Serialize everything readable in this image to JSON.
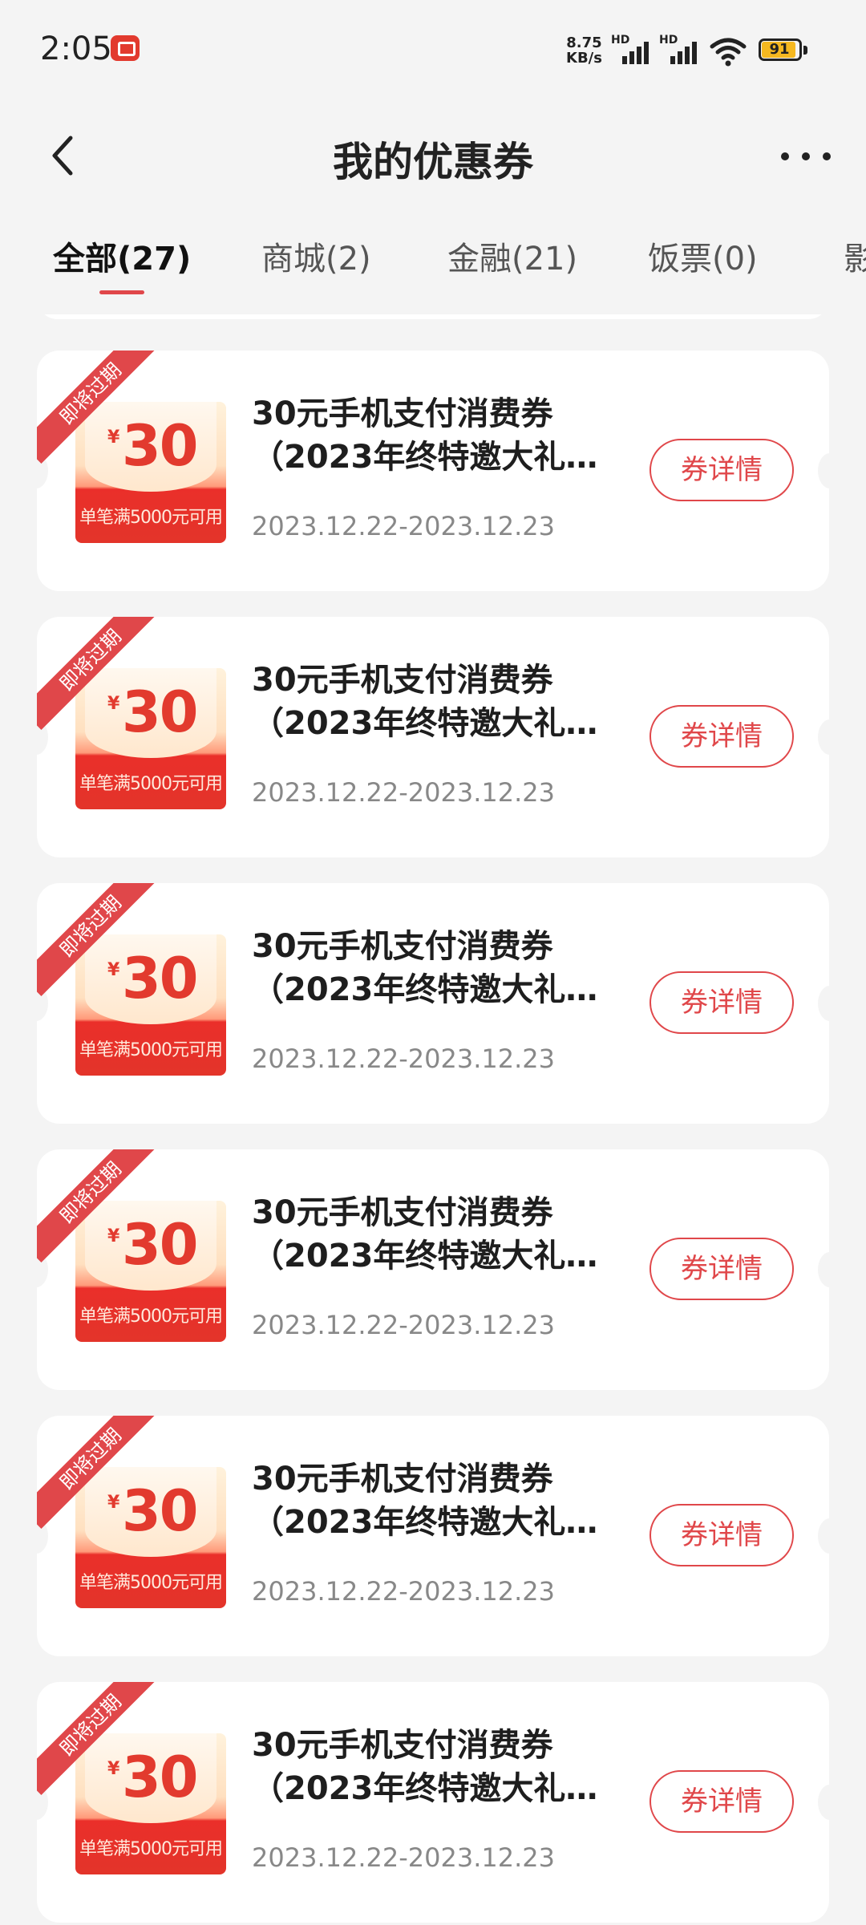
{
  "status_bar": {
    "time": "2:05",
    "net_speed_value": "8.75",
    "net_speed_unit": "KB/s",
    "hd_label": "HD",
    "battery": "91"
  },
  "header": {
    "title": "我的优惠券"
  },
  "tabs": [
    {
      "label": "全部(27)",
      "active": true
    },
    {
      "label": "商城(2)"
    },
    {
      "label": "金融(21)"
    },
    {
      "label": "饭票(0)"
    },
    {
      "label": "影"
    }
  ],
  "coupons": [
    {
      "ribbon": "即将过期",
      "currency": "¥",
      "amount": "30",
      "condition": "单笔满5000元可用",
      "title_line1": "30元手机支付消费券",
      "title_line2": "（2023年终特邀大礼…",
      "date": "2023.12.22-2023.12.23",
      "button": "券详情"
    },
    {
      "ribbon": "即将过期",
      "currency": "¥",
      "amount": "30",
      "condition": "单笔满5000元可用",
      "title_line1": "30元手机支付消费券",
      "title_line2": "（2023年终特邀大礼…",
      "date": "2023.12.22-2023.12.23",
      "button": "券详情"
    },
    {
      "ribbon": "即将过期",
      "currency": "¥",
      "amount": "30",
      "condition": "单笔满5000元可用",
      "title_line1": "30元手机支付消费券",
      "title_line2": "（2023年终特邀大礼…",
      "date": "2023.12.22-2023.12.23",
      "button": "券详情"
    },
    {
      "ribbon": "即将过期",
      "currency": "¥",
      "amount": "30",
      "condition": "单笔满5000元可用",
      "title_line1": "30元手机支付消费券",
      "title_line2": "（2023年终特邀大礼…",
      "date": "2023.12.22-2023.12.23",
      "button": "券详情"
    },
    {
      "ribbon": "即将过期",
      "currency": "¥",
      "amount": "30",
      "condition": "单笔满5000元可用",
      "title_line1": "30元手机支付消费券",
      "title_line2": "（2023年终特邀大礼…",
      "date": "2023.12.22-2023.12.23",
      "button": "券详情"
    },
    {
      "ribbon": "即将过期",
      "currency": "¥",
      "amount": "30",
      "condition": "单笔满5000元可用",
      "title_line1": "30元手机支付消费券",
      "title_line2": "（2023年终特邀大礼…",
      "date": "2023.12.22-2023.12.23",
      "button": "券详情"
    }
  ],
  "colors": {
    "accent": "#e0474a",
    "background": "#f4f4f4",
    "card": "#ffffff"
  },
  "icons": [
    "back-arrow-icon",
    "more-dots-icon",
    "signal-icon",
    "wifi-icon",
    "battery-icon",
    "app-notification-icon"
  ]
}
